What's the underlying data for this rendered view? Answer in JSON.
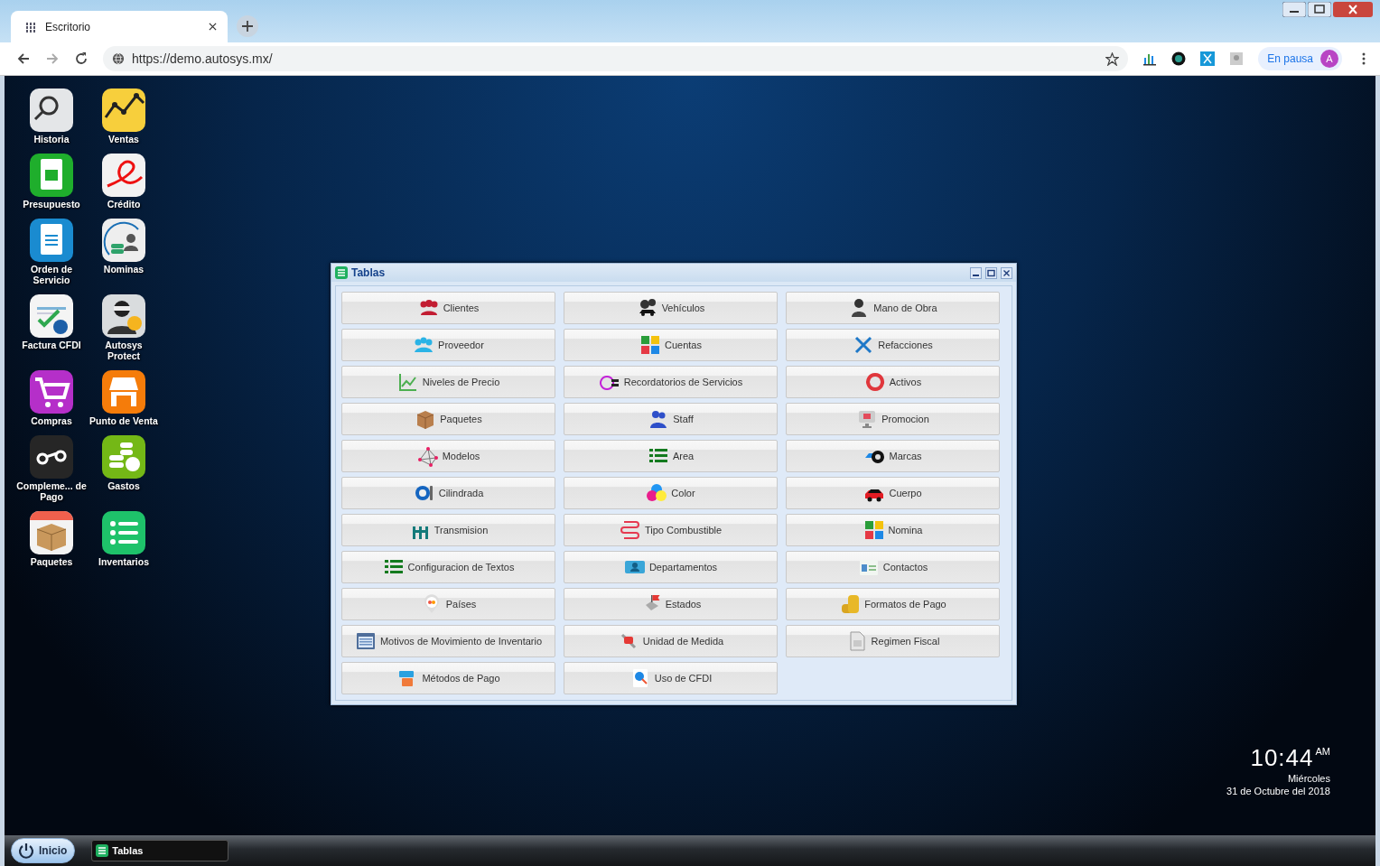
{
  "browser": {
    "tab": {
      "title": "Escritorio",
      "selected": true
    },
    "address": "https://demo.autosys.mx/",
    "profile": {
      "status": "En pausa",
      "avatar": "A"
    }
  },
  "desktop_icons": [
    {
      "label": "Historia",
      "color": "#e4e6e8"
    },
    {
      "label": "Ventas",
      "color": "#f7cf3c"
    },
    {
      "label": "Presupuesto",
      "color": "#1fae2c"
    },
    {
      "label": "Crédito",
      "color": "#f2f2f2"
    },
    {
      "label": "Orden de Servicio",
      "color": "#1a8bd0"
    },
    {
      "label": "Nominas",
      "color": "#eeeeee"
    },
    {
      "label": "Factura CFDI",
      "color": "#f4f4f4"
    },
    {
      "label": "Autosys Protect",
      "color": "#d9dcde"
    },
    {
      "label": "Compras",
      "color": "#b52fc9"
    },
    {
      "label": "Punto de Venta",
      "color": "#f57c0a"
    },
    {
      "label": "Compleme... de Pago",
      "color": "#262626"
    },
    {
      "label": "Gastos",
      "color": "#74b816"
    },
    {
      "label": "Paquetes",
      "color": "#f3f3f3"
    },
    {
      "label": "Inventarios",
      "color": "#1ec26a"
    }
  ],
  "window": {
    "title": "Tablas",
    "buttons": [
      "Clientes",
      "Vehículos",
      "Mano de Obra",
      "Proveedor",
      "Cuentas",
      "Refacciones",
      "Niveles de Precio",
      "Recordatorios de Servicios",
      "Activos",
      "Paquetes",
      "Staff",
      "Promocion",
      "Modelos",
      "Area",
      "Marcas",
      "Cilindrada",
      "Color",
      "Cuerpo",
      "Transmision",
      "Tipo Combustible",
      "Nomina",
      "Configuracion de Textos",
      "Departamentos",
      "Contactos",
      "Países",
      "Estados",
      "Formatos de Pago",
      "Motivos de Movimiento de Inventario",
      "Unidad de Medida",
      "Regimen Fiscal",
      "Métodos de Pago",
      "Uso de CFDI"
    ]
  },
  "clock": {
    "time": "10:44",
    "meridiem": "AM",
    "weekday": "Miércoles",
    "date": "31 de Octubre del 2018"
  },
  "taskbar": {
    "start": "Inicio",
    "tasks": [
      {
        "label": "Tablas",
        "selected": false
      }
    ]
  }
}
